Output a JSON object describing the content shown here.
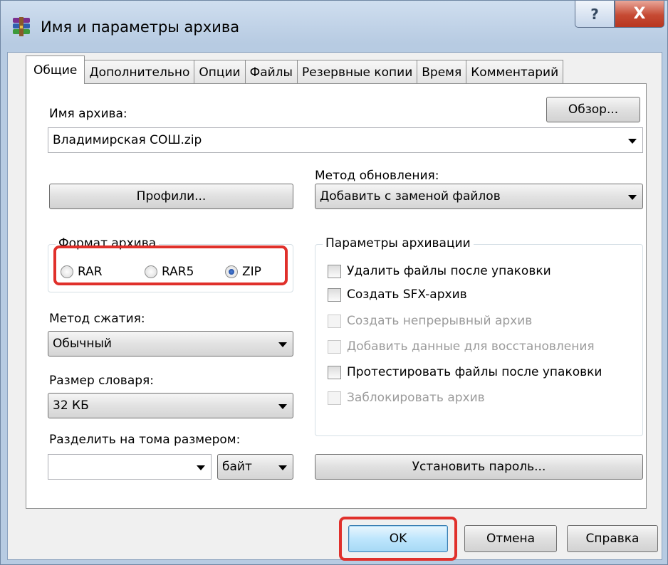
{
  "window": {
    "title": "Имя и параметры архива",
    "help_glyph": "?",
    "close_glyph": "X"
  },
  "tabs": [
    {
      "label": "Общие",
      "active": true
    },
    {
      "label": "Дополнительно"
    },
    {
      "label": "Опции"
    },
    {
      "label": "Файлы"
    },
    {
      "label": "Резервные копии"
    },
    {
      "label": "Время"
    },
    {
      "label": "Комментарий"
    }
  ],
  "general": {
    "archive_name_label": "Имя архива:",
    "browse_button": "Обзор...",
    "archive_name_value": "Владимирская СОШ.zip",
    "update_method_label": "Метод обновления:",
    "update_method_value": "Добавить с заменой файлов",
    "profiles_button": "Профили...",
    "format": {
      "title": "Формат архива",
      "options": [
        {
          "label": "RAR",
          "checked": false
        },
        {
          "label": "RAR5",
          "checked": false
        },
        {
          "label": "ZIP",
          "checked": true
        }
      ]
    },
    "compression_label": "Метод сжатия:",
    "compression_value": "Обычный",
    "dictionary_label": "Размер словаря:",
    "dictionary_value": "32 КБ",
    "split_label": "Разделить на тома размером:",
    "split_value": "",
    "split_unit": "байт",
    "options": {
      "title": "Параметры архивации",
      "items": [
        {
          "label": "Удалить файлы после упаковки",
          "enabled": true
        },
        {
          "label": "Создать SFX-архив",
          "enabled": true
        },
        {
          "label": "Создать непрерывный архив",
          "enabled": false
        },
        {
          "label": "Добавить данные для восстановления",
          "enabled": false
        },
        {
          "label": "Протестировать файлы после упаковки",
          "enabled": true
        },
        {
          "label": "Заблокировать архив",
          "enabled": false
        }
      ]
    },
    "password_button": "Установить пароль..."
  },
  "footer": {
    "ok": "OK",
    "cancel": "Отмена",
    "help": "Справка"
  },
  "colors": {
    "highlight": "#e0302b",
    "accent": "#3c7fb1"
  }
}
